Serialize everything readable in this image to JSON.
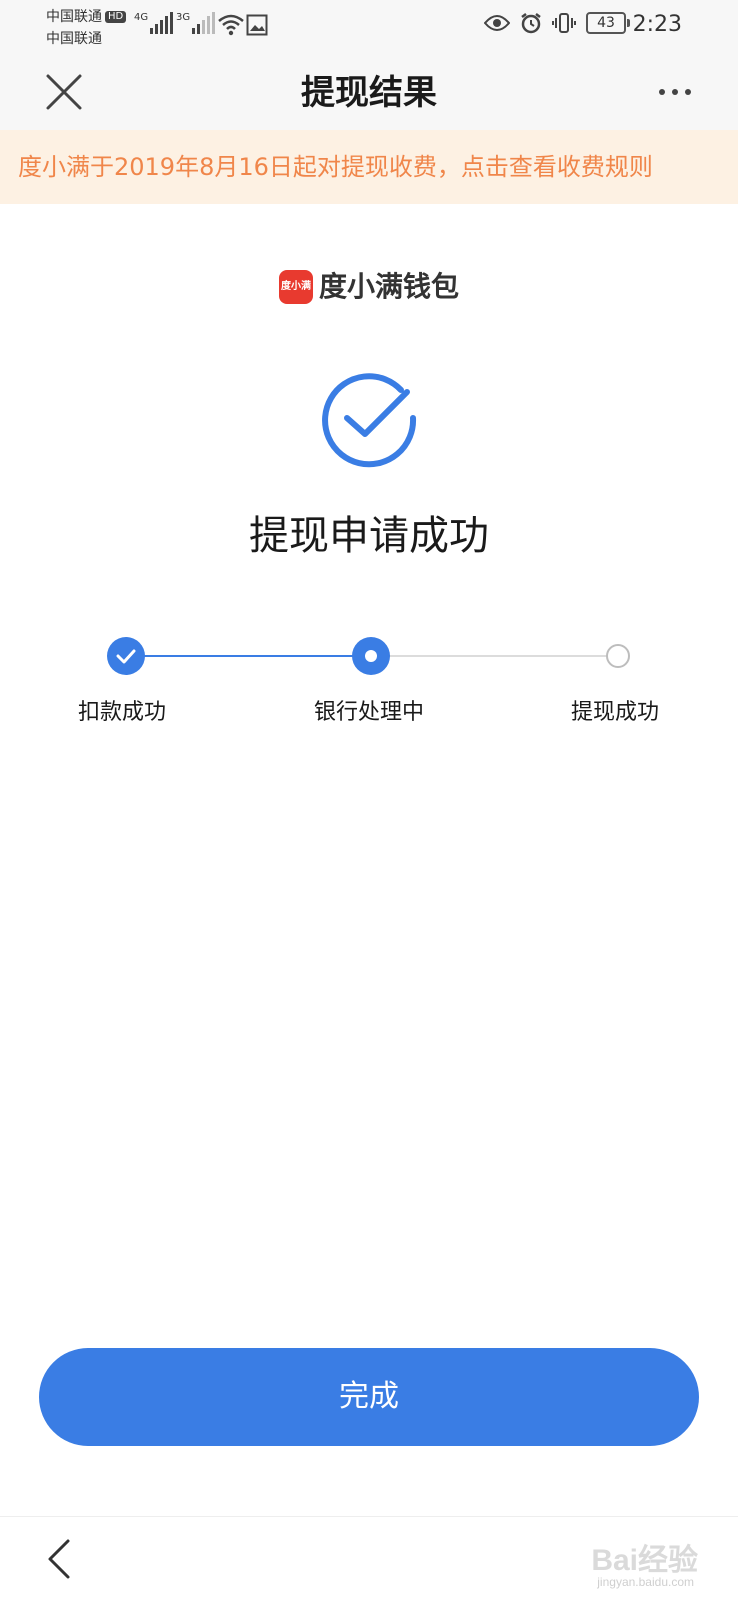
{
  "status_bar": {
    "carrier_1": "中国联通",
    "carrier_1_badge": "HD",
    "carrier_2": "中国联通",
    "network_1": "4G",
    "network_2": "3G",
    "battery": "43",
    "time": "2:23"
  },
  "nav": {
    "title": "提现结果"
  },
  "notice": {
    "text": "度小满于2019年8月16日起对提现收费，点击查看收费规则"
  },
  "brand": {
    "logo_text": "度小满",
    "name": "度小满钱包"
  },
  "result": {
    "title": "提现申请成功"
  },
  "progress": {
    "steps": [
      {
        "label": "扣款成功",
        "state": "done"
      },
      {
        "label": "银行处理中",
        "state": "current"
      },
      {
        "label": "提现成功",
        "state": "pending"
      }
    ]
  },
  "actions": {
    "done_label": "完成"
  },
  "watermark": {
    "text": "Bai经验",
    "sub": "jingyan.baidu.com"
  },
  "colors": {
    "accent": "#3a7de4",
    "notice_bg": "#fdf1e3",
    "notice_text": "#f0864a",
    "brand_red": "#e83a2f"
  }
}
